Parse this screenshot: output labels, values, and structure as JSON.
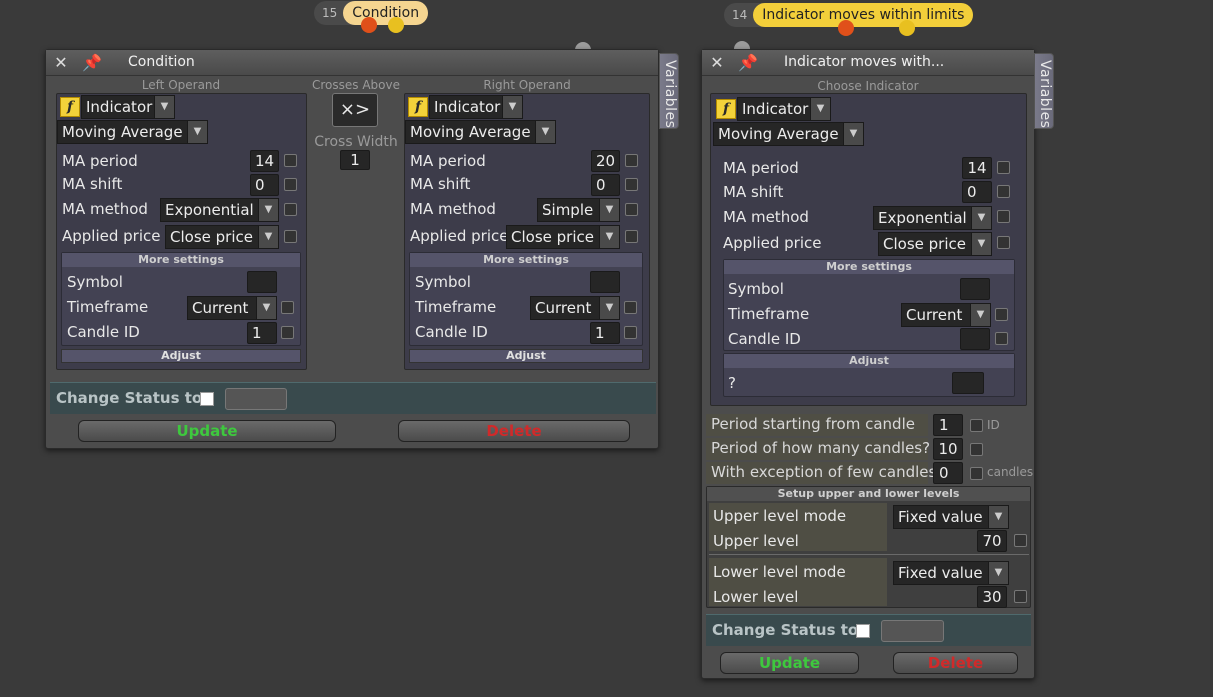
{
  "tags": {
    "left": {
      "number": "15",
      "label": "Condition"
    },
    "right": {
      "number": "14",
      "label": "Indicator moves within limits"
    }
  },
  "icons": {
    "close": "close-icon",
    "pin": "pin-icon",
    "function": "function-icon",
    "dropdown": "chevron-down-icon"
  },
  "condition_panel": {
    "title": "Condition",
    "variables_tab": "Variables",
    "left_operand": {
      "heading": "Left Operand",
      "source_type": "Indicator",
      "indicator": "Moving Average",
      "fx": "f",
      "params": {
        "ma_period": {
          "label": "MA period",
          "value": "14"
        },
        "ma_shift": {
          "label": "MA shift",
          "value": "0"
        },
        "ma_method": {
          "label": "MA method",
          "value": "Exponential"
        },
        "applied_price": {
          "label": "Applied price",
          "value": "Close price"
        }
      },
      "more_settings": "More settings",
      "symbol": {
        "label": "Symbol",
        "value": ""
      },
      "timeframe": {
        "label": "Timeframe",
        "value": "Current"
      },
      "candle_id": {
        "label": "Candle ID",
        "value": "1"
      },
      "adjust": "Adjust"
    },
    "operator": {
      "heading": "Crosses Above",
      "symbol": "×>",
      "cross_width_label": "Cross Width",
      "cross_width_value": "1"
    },
    "right_operand": {
      "heading": "Right Operand",
      "source_type": "Indicator",
      "indicator": "Moving Average",
      "fx": "f",
      "params": {
        "ma_period": {
          "label": "MA period",
          "value": "20"
        },
        "ma_shift": {
          "label": "MA shift",
          "value": "0"
        },
        "ma_method": {
          "label": "MA method",
          "value": "Simple"
        },
        "applied_price": {
          "label": "Applied price",
          "value": "Close price"
        }
      },
      "more_settings": "More settings",
      "symbol": {
        "label": "Symbol",
        "value": ""
      },
      "timeframe": {
        "label": "Timeframe",
        "value": "Current"
      },
      "candle_id": {
        "label": "Candle ID",
        "value": "1"
      },
      "adjust": "Adjust"
    },
    "change_status": "Change Status to",
    "update": "Update",
    "delete": "Delete"
  },
  "indicator_panel": {
    "title": "Indicator moves with...",
    "variables_tab": "Variables",
    "choose_heading": "Choose Indicator",
    "source_type": "Indicator",
    "indicator": "Moving Average",
    "fx": "f",
    "params": {
      "ma_period": {
        "label": "MA period",
        "value": "14"
      },
      "ma_shift": {
        "label": "MA shift",
        "value": "0"
      },
      "ma_method": {
        "label": "MA method",
        "value": "Exponential"
      },
      "applied_price": {
        "label": "Applied price",
        "value": "Close price"
      }
    },
    "more_settings": "More settings",
    "symbol": {
      "label": "Symbol",
      "value": ""
    },
    "timeframe": {
      "label": "Timeframe",
      "value": "Current"
    },
    "candle_id": {
      "label": "Candle ID",
      "value": ""
    },
    "adjust": "Adjust",
    "adjust_q": {
      "label": "?",
      "value": ""
    },
    "period_start": {
      "label": "Period starting from candle",
      "value": "1",
      "suffix": "ID"
    },
    "period_count": {
      "label": "Period of how many candles?",
      "value": "10"
    },
    "exception": {
      "label": "With exception of few candles",
      "value": "0",
      "suffix": "candles"
    },
    "levels_heading": "Setup upper and lower levels",
    "upper_mode": {
      "label": "Upper level mode",
      "value": "Fixed value"
    },
    "upper_level": {
      "label": "Upper level",
      "value": "70"
    },
    "lower_mode": {
      "label": "Lower level mode",
      "value": "Fixed value"
    },
    "lower_level": {
      "label": "Lower level",
      "value": "30"
    },
    "change_status": "Change Status to",
    "update": "Update",
    "delete": "Delete"
  }
}
